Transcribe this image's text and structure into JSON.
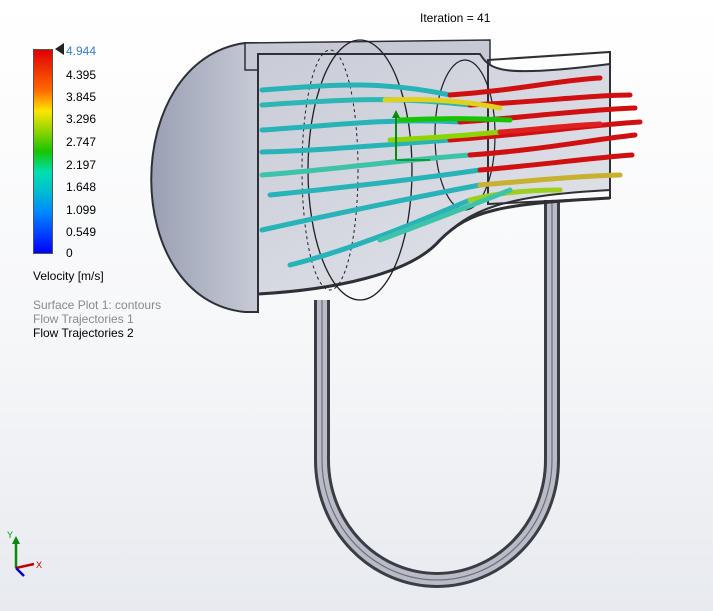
{
  "iteration_label": "Iteration = 41",
  "legend": {
    "ticks": [
      "4.944",
      "4.395",
      "3.845",
      "3.296",
      "2.747",
      "2.197",
      "1.648",
      "1.099",
      "0.549",
      "0"
    ],
    "title": "Velocity [m/s]",
    "colors": [
      "#e00000",
      "#ff6a00",
      "#ffe600",
      "#8fd400",
      "#18c400",
      "#00e0b0",
      "#00bcd0",
      "#0088ff",
      "#0000ff"
    ]
  },
  "plots": [
    {
      "label": "Surface Plot 1: contours",
      "color": "#8a8a8a"
    },
    {
      "label": "Flow Trajectories 1",
      "color": "#8a8a8a"
    },
    {
      "label": "Flow Trajectories 2",
      "color": "#000000"
    }
  ],
  "axes": {
    "y": "Y",
    "x": "X"
  }
}
